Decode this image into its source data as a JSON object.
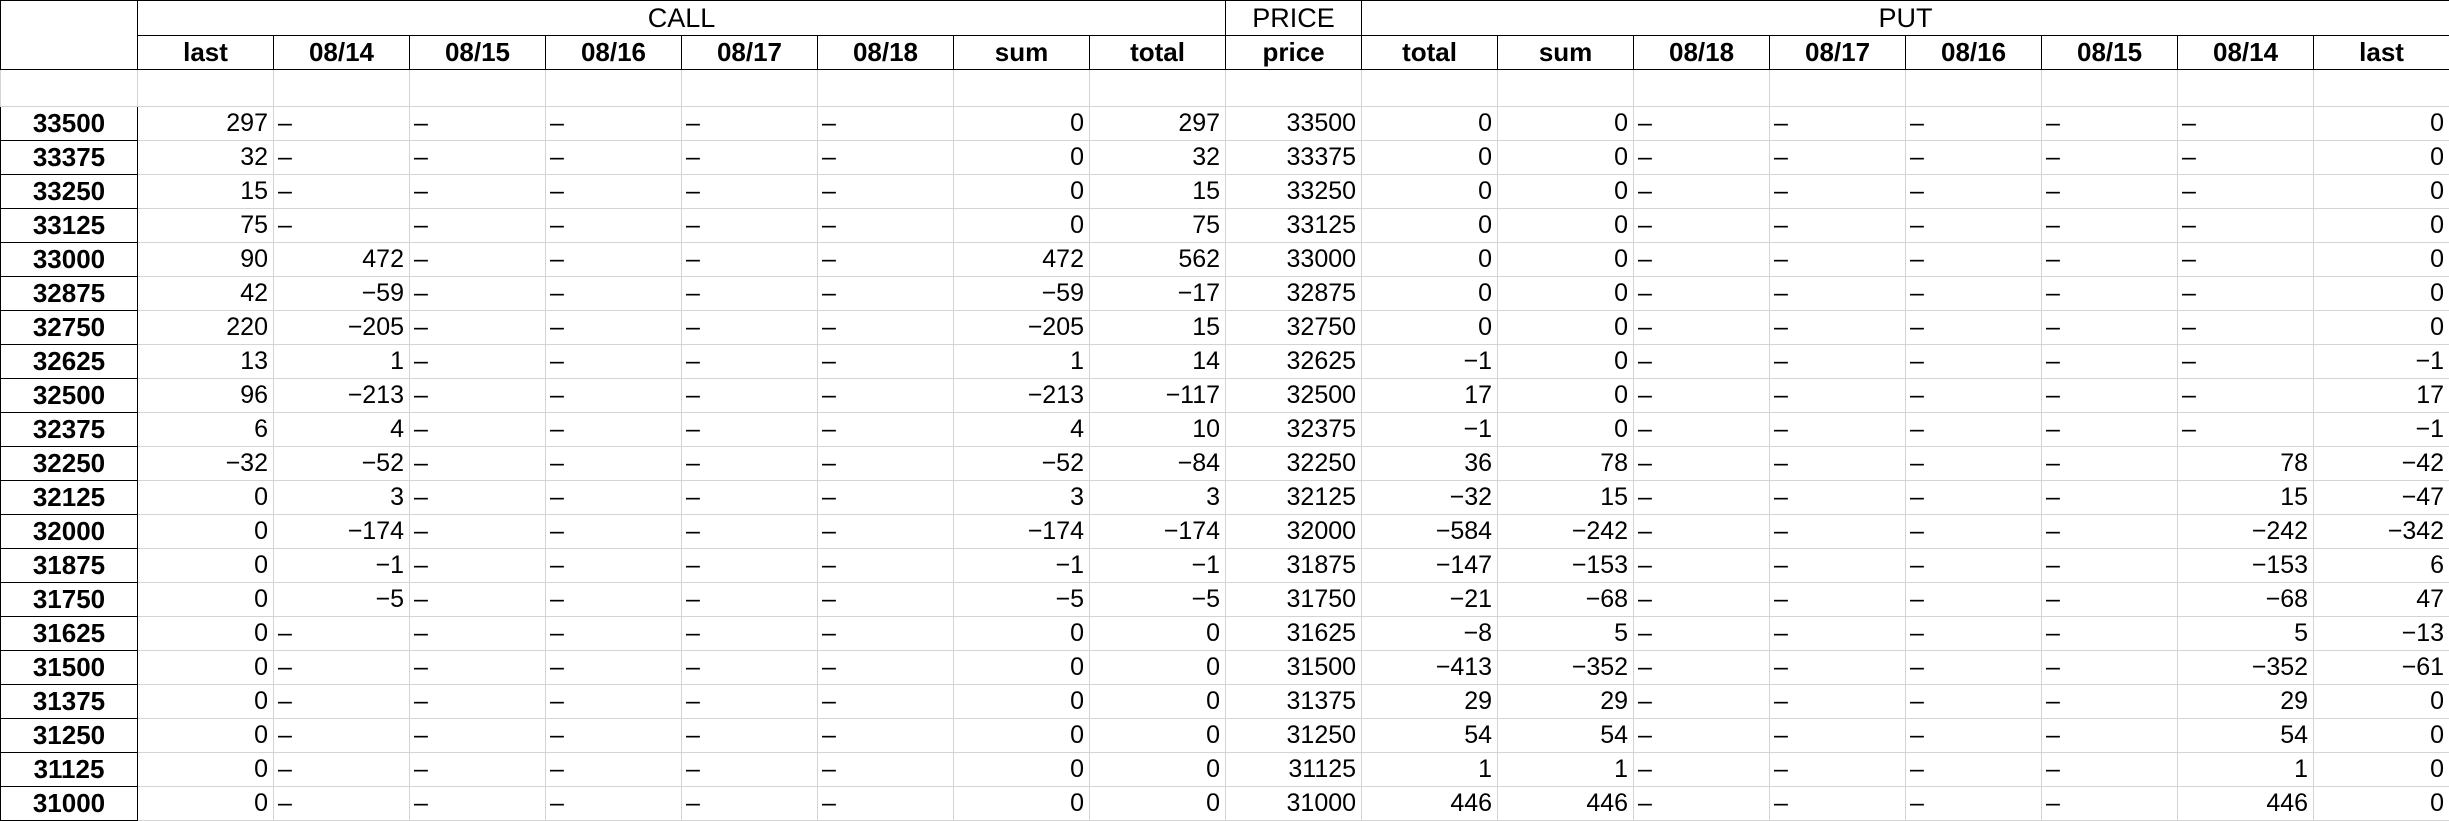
{
  "groups": {
    "call": "CALL",
    "price": "PRICE",
    "put": "PUT"
  },
  "call_columns": [
    "last",
    "08/14",
    "08/15",
    "08/16",
    "08/17",
    "08/18",
    "sum",
    "total"
  ],
  "price_column": "price",
  "put_columns": [
    "total",
    "sum",
    "08/18",
    "08/17",
    "08/16",
    "08/15",
    "08/14",
    "last"
  ],
  "dash": "–",
  "rows": [
    {
      "strike": "33500",
      "call": [
        "297",
        "–",
        "–",
        "–",
        "–",
        "–",
        "0",
        "297"
      ],
      "price": "33500",
      "put": [
        "0",
        "0",
        "–",
        "–",
        "–",
        "–",
        "–",
        "0"
      ]
    },
    {
      "strike": "33375",
      "call": [
        "32",
        "–",
        "–",
        "–",
        "–",
        "–",
        "0",
        "32"
      ],
      "price": "33375",
      "put": [
        "0",
        "0",
        "–",
        "–",
        "–",
        "–",
        "–",
        "0"
      ]
    },
    {
      "strike": "33250",
      "call": [
        "15",
        "–",
        "–",
        "–",
        "–",
        "–",
        "0",
        "15"
      ],
      "price": "33250",
      "put": [
        "0",
        "0",
        "–",
        "–",
        "–",
        "–",
        "–",
        "0"
      ]
    },
    {
      "strike": "33125",
      "call": [
        "75",
        "–",
        "–",
        "–",
        "–",
        "–",
        "0",
        "75"
      ],
      "price": "33125",
      "put": [
        "0",
        "0",
        "–",
        "–",
        "–",
        "–",
        "–",
        "0"
      ]
    },
    {
      "strike": "33000",
      "call": [
        "90",
        "472",
        "–",
        "–",
        "–",
        "–",
        "472",
        "562"
      ],
      "price": "33000",
      "put": [
        "0",
        "0",
        "–",
        "–",
        "–",
        "–",
        "–",
        "0"
      ]
    },
    {
      "strike": "32875",
      "call": [
        "42",
        "−59",
        "–",
        "–",
        "–",
        "–",
        "−59",
        "−17"
      ],
      "price": "32875",
      "put": [
        "0",
        "0",
        "–",
        "–",
        "–",
        "–",
        "–",
        "0"
      ]
    },
    {
      "strike": "32750",
      "call": [
        "220",
        "−205",
        "–",
        "–",
        "–",
        "–",
        "−205",
        "15"
      ],
      "price": "32750",
      "put": [
        "0",
        "0",
        "–",
        "–",
        "–",
        "–",
        "–",
        "0"
      ]
    },
    {
      "strike": "32625",
      "call": [
        "13",
        "1",
        "–",
        "–",
        "–",
        "–",
        "1",
        "14"
      ],
      "price": "32625",
      "put": [
        "−1",
        "0",
        "–",
        "–",
        "–",
        "–",
        "–",
        "−1"
      ]
    },
    {
      "strike": "32500",
      "call": [
        "96",
        "−213",
        "–",
        "–",
        "–",
        "–",
        "−213",
        "−117"
      ],
      "price": "32500",
      "put": [
        "17",
        "0",
        "–",
        "–",
        "–",
        "–",
        "–",
        "17"
      ]
    },
    {
      "strike": "32375",
      "call": [
        "6",
        "4",
        "–",
        "–",
        "–",
        "–",
        "4",
        "10"
      ],
      "price": "32375",
      "put": [
        "−1",
        "0",
        "–",
        "–",
        "–",
        "–",
        "–",
        "−1"
      ]
    },
    {
      "strike": "32250",
      "call": [
        "−32",
        "−52",
        "–",
        "–",
        "–",
        "–",
        "−52",
        "−84"
      ],
      "price": "32250",
      "put": [
        "36",
        "78",
        "–",
        "–",
        "–",
        "–",
        "78",
        "−42"
      ]
    },
    {
      "strike": "32125",
      "call": [
        "0",
        "3",
        "–",
        "–",
        "–",
        "–",
        "3",
        "3"
      ],
      "price": "32125",
      "put": [
        "−32",
        "15",
        "–",
        "–",
        "–",
        "–",
        "15",
        "−47"
      ]
    },
    {
      "strike": "32000",
      "call": [
        "0",
        "−174",
        "–",
        "–",
        "–",
        "–",
        "−174",
        "−174"
      ],
      "price": "32000",
      "put": [
        "−584",
        "−242",
        "–",
        "–",
        "–",
        "–",
        "−242",
        "−342"
      ]
    },
    {
      "strike": "31875",
      "call": [
        "0",
        "−1",
        "–",
        "–",
        "–",
        "–",
        "−1",
        "−1"
      ],
      "price": "31875",
      "put": [
        "−147",
        "−153",
        "–",
        "–",
        "–",
        "–",
        "−153",
        "6"
      ]
    },
    {
      "strike": "31750",
      "call": [
        "0",
        "−5",
        "–",
        "–",
        "–",
        "–",
        "−5",
        "−5"
      ],
      "price": "31750",
      "put": [
        "−21",
        "−68",
        "–",
        "–",
        "–",
        "–",
        "−68",
        "47"
      ]
    },
    {
      "strike": "31625",
      "call": [
        "0",
        "–",
        "–",
        "–",
        "–",
        "–",
        "0",
        "0"
      ],
      "price": "31625",
      "put": [
        "−8",
        "5",
        "–",
        "–",
        "–",
        "–",
        "5",
        "−13"
      ]
    },
    {
      "strike": "31500",
      "call": [
        "0",
        "–",
        "–",
        "–",
        "–",
        "–",
        "0",
        "0"
      ],
      "price": "31500",
      "put": [
        "−413",
        "−352",
        "–",
        "–",
        "–",
        "–",
        "−352",
        "−61"
      ]
    },
    {
      "strike": "31375",
      "call": [
        "0",
        "–",
        "–",
        "–",
        "–",
        "–",
        "0",
        "0"
      ],
      "price": "31375",
      "put": [
        "29",
        "29",
        "–",
        "–",
        "–",
        "–",
        "29",
        "0"
      ]
    },
    {
      "strike": "31250",
      "call": [
        "0",
        "–",
        "–",
        "–",
        "–",
        "–",
        "0",
        "0"
      ],
      "price": "31250",
      "put": [
        "54",
        "54",
        "–",
        "–",
        "–",
        "–",
        "54",
        "0"
      ]
    },
    {
      "strike": "31125",
      "call": [
        "0",
        "–",
        "–",
        "–",
        "–",
        "–",
        "0",
        "0"
      ],
      "price": "31125",
      "put": [
        "1",
        "1",
        "–",
        "–",
        "–",
        "–",
        "1",
        "0"
      ]
    },
    {
      "strike": "31000",
      "call": [
        "0",
        "–",
        "–",
        "–",
        "–",
        "–",
        "0",
        "0"
      ],
      "price": "31000",
      "put": [
        "446",
        "446",
        "–",
        "–",
        "–",
        "–",
        "446",
        "0"
      ]
    }
  ]
}
